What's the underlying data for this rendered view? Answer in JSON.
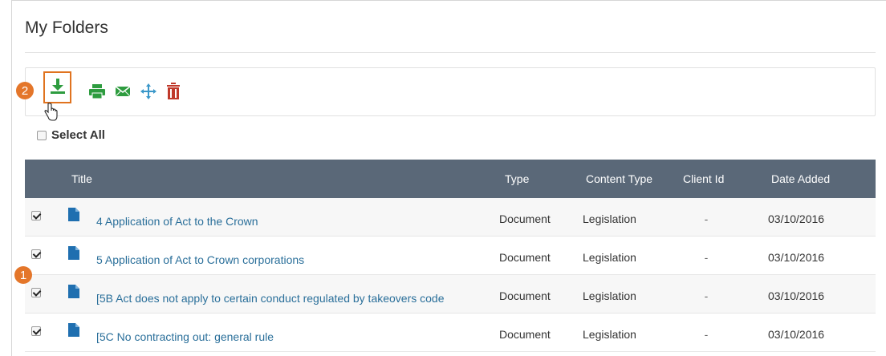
{
  "page": {
    "title": "My Folders"
  },
  "toolbar": {
    "buttons": [
      {
        "name": "download",
        "icon": "download-icon",
        "color": "#2e9c3f"
      },
      {
        "name": "print",
        "icon": "printer-icon",
        "color": "#2e9c3f"
      },
      {
        "name": "email",
        "icon": "envelope-icon",
        "color": "#2e9c3f"
      },
      {
        "name": "move",
        "icon": "move-arrows-icon",
        "color": "#3a97c9"
      },
      {
        "name": "delete",
        "icon": "trash-icon",
        "color": "#c0392b"
      }
    ]
  },
  "callouts": {
    "one": "1",
    "two": "2"
  },
  "select_all": {
    "label": "Select All",
    "checked": false
  },
  "table": {
    "columns": [
      "Title",
      "Type",
      "Content Type",
      "Client Id",
      "Date Added"
    ],
    "rows": [
      {
        "title": "4 Application of Act to the Crown",
        "type": "Document",
        "content_type": "Legislation",
        "client_id": "-",
        "date_added": "03/10/2016",
        "checked": true
      },
      {
        "title": "5 Application of Act to Crown corporations",
        "type": "Document",
        "content_type": "Legislation",
        "client_id": "-",
        "date_added": "03/10/2016",
        "checked": true
      },
      {
        "title": "[5B Act does not apply to certain conduct regulated by takeovers code",
        "type": "Document",
        "content_type": "Legislation",
        "client_id": "-",
        "date_added": "03/10/2016",
        "checked": true
      },
      {
        "title": "[5C No contracting out: general rule",
        "type": "Document",
        "content_type": "Legislation",
        "client_id": "-",
        "date_added": "03/10/2016",
        "checked": true
      }
    ]
  },
  "colors": {
    "header_bg": "#5a6878",
    "link": "#2a6f9a",
    "callout": "#e4762a",
    "highlight_border": "#e0731f"
  }
}
